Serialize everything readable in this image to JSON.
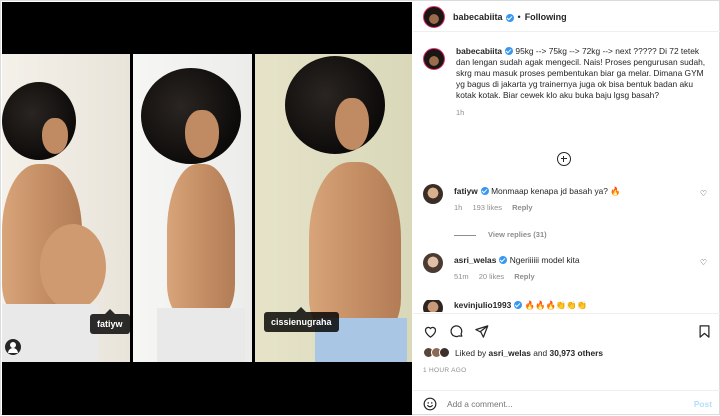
{
  "post": {
    "username": "babecabiita",
    "follow_state": "Following",
    "dot": "•",
    "caption_text": "95kg --> 75kg --> 72kg --> next ????? Di 72 tetek dan lengan sudah agak mengecil. Nais! Proses pengurusan sudah, skrg mau masuk proses pembentukan biar ga melar. Dimana GYM yg bagus di jakarta yg trainernya juga ok bisa bentuk badan aku kotak kotak. Biar cewek klo aku buka baju lgsg basah?",
    "caption_time": "1h"
  },
  "photo_tags": [
    "fatiyw",
    "cissienugraha"
  ],
  "comments": [
    {
      "user": "fatiyw",
      "text": "Monmaap kenapa jd basah ya? 🔥",
      "time": "1h",
      "likes": "193 likes",
      "reply": "Reply"
    },
    {
      "user": "asri_welas",
      "text": "Ngeriiiiii model kita",
      "time": "51m",
      "likes": "20 likes",
      "reply": "Reply"
    },
    {
      "user": "kevinjulio1993",
      "text": "🔥🔥🔥👏👏👏"
    }
  ],
  "view_replies": "View replies (31)",
  "likes": {
    "prefix": "Liked by",
    "user": "asri_welas",
    "and": "and",
    "others": "30,973 others"
  },
  "post_age": "1 HOUR AGO",
  "add_comment": {
    "placeholder": "Add a comment...",
    "post_label": "Post"
  },
  "icons": [
    "heart-icon",
    "comment-icon",
    "share-icon",
    "bookmark-icon",
    "emoji-icon",
    "plus-circle-icon",
    "verified-icon",
    "user-tag-icon"
  ],
  "colors": {
    "verified": "#3897f0",
    "post_disabled": "#b2dffc",
    "muted": "#8e8e8e"
  }
}
